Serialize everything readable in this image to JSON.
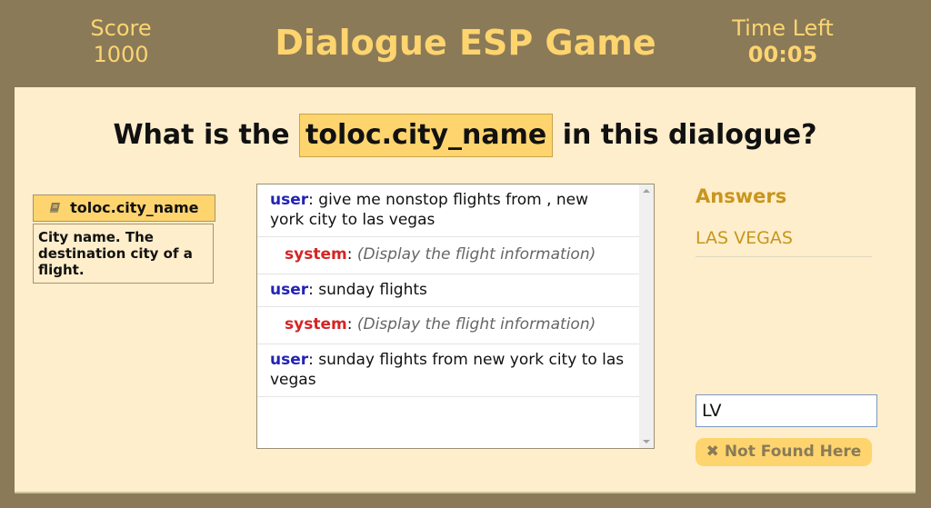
{
  "header": {
    "score_label": "Score",
    "score_value": "1000",
    "title": "Dialogue ESP Game",
    "time_label": "Time Left",
    "time_value": "00:05"
  },
  "question": {
    "prefix": "What is the",
    "slot": "toloc.city_name",
    "suffix": "in this dialogue?"
  },
  "slot_info": {
    "icon": "book-icon",
    "name": "toloc.city_name",
    "description": "City name. The destination city of a flight."
  },
  "dialogue": {
    "turns": [
      {
        "speaker": "user",
        "text": "give me nonstop flights from , new york city to las vegas"
      },
      {
        "speaker": "system",
        "text": "(Display the flight information)"
      },
      {
        "speaker": "user",
        "text": "sunday flights"
      },
      {
        "speaker": "system",
        "text": "(Display the flight information)"
      },
      {
        "speaker": "user",
        "text": "sunday flights from new york city to las vegas"
      }
    ]
  },
  "answers": {
    "title": "Answers",
    "items": [
      "LAS VEGAS"
    ],
    "input_value": "LV",
    "not_found_label": "Not Found Here",
    "not_found_icon": "close-icon"
  },
  "colors": {
    "frame": "#8a7a57",
    "accent": "#fdd46e",
    "panel": "#ffeecb",
    "user": "#2323b5",
    "system": "#d42525",
    "answer": "#c8961d"
  }
}
